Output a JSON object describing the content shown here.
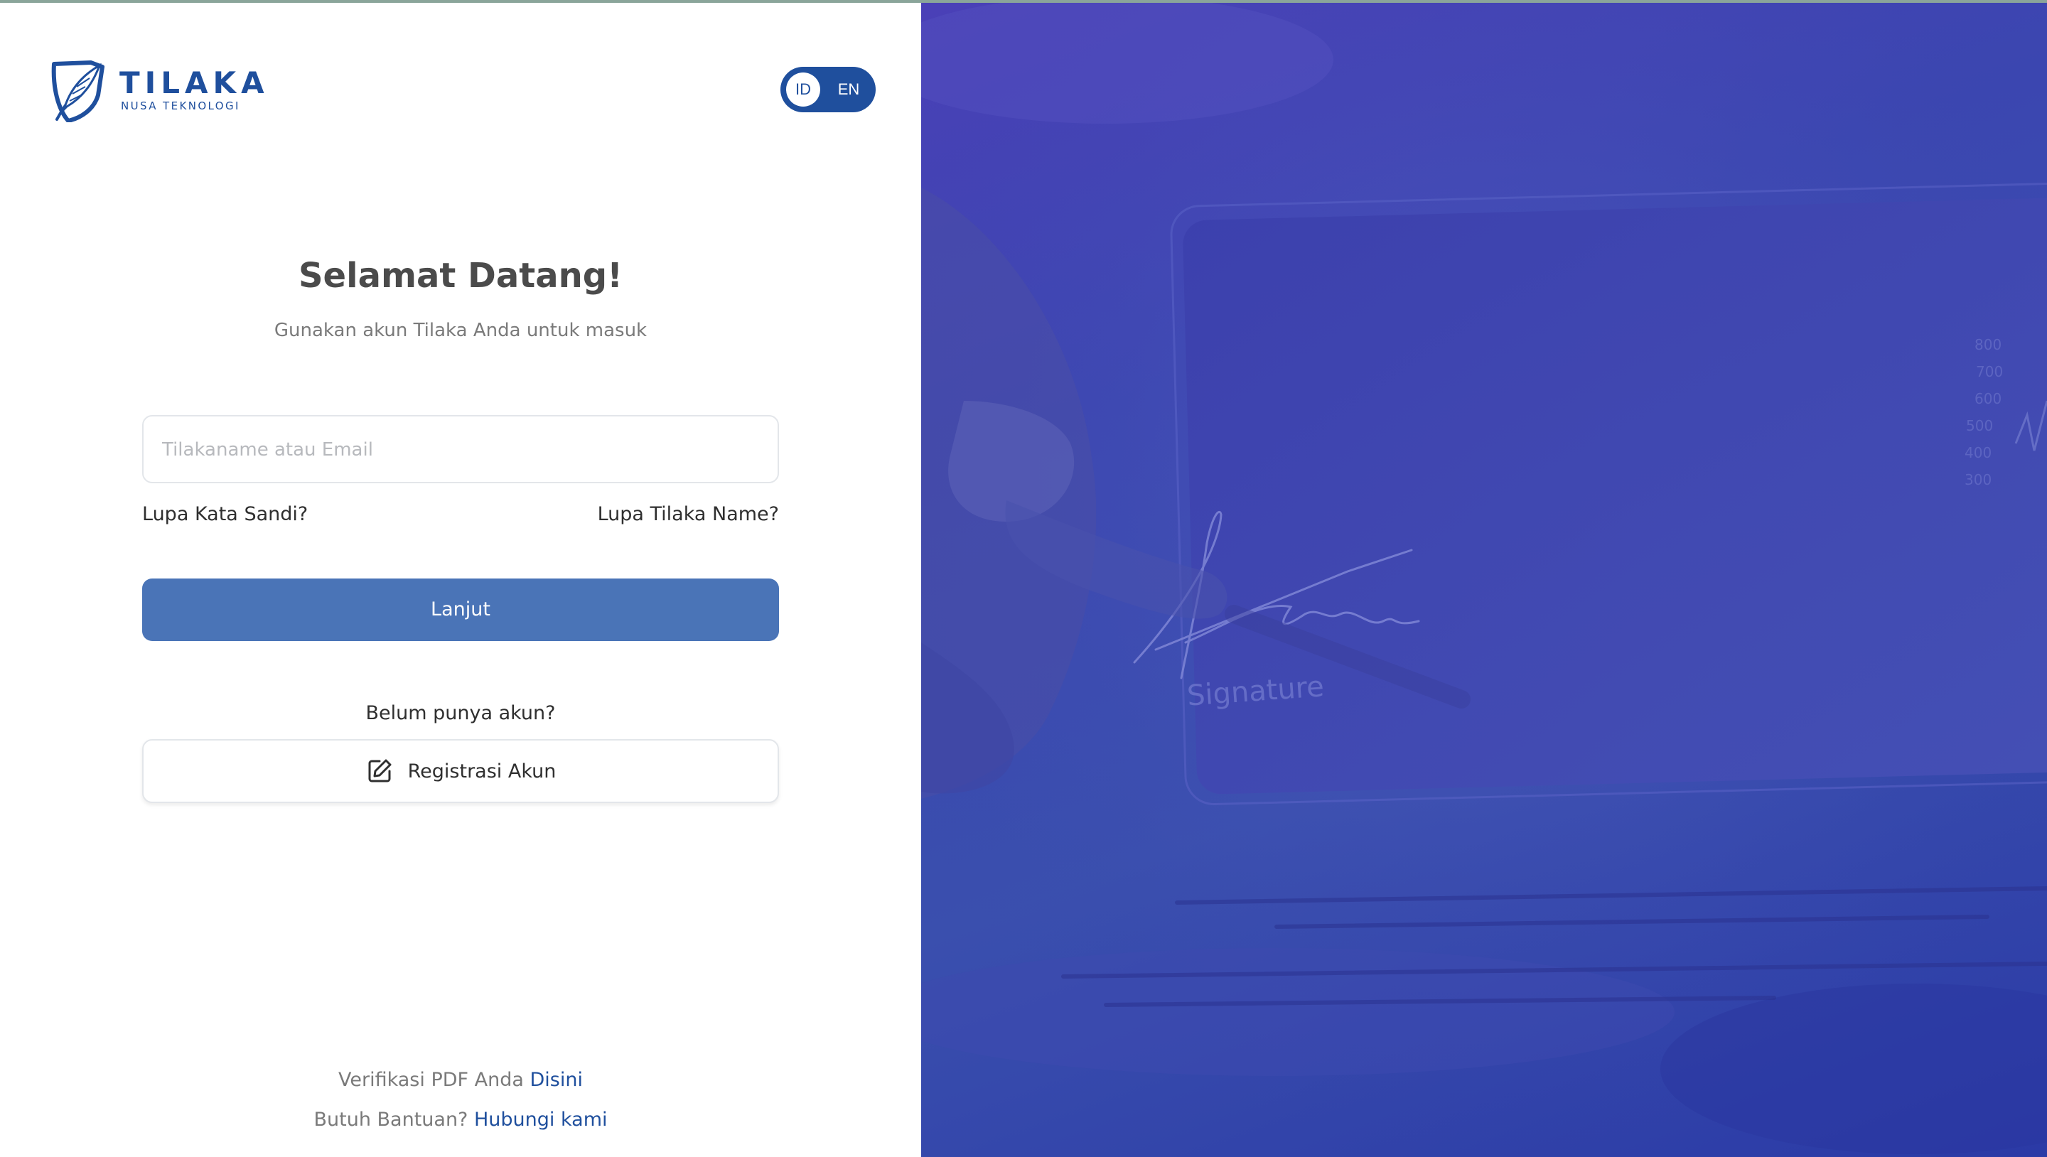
{
  "brand": {
    "name": "TILAKA",
    "tagline": "NUSA TEKNOLOGI",
    "color": "#1f4f9d"
  },
  "language": {
    "options": [
      "ID",
      "EN"
    ],
    "selected": "ID"
  },
  "login": {
    "title": "Selamat Datang!",
    "subtitle": "Gunakan akun Tilaka Anda untuk masuk",
    "username_placeholder": "Tilakaname atau Email",
    "username_value": "",
    "forgot_password": "Lupa Kata Sandi?",
    "forgot_tilaka_name": "Lupa Tilaka Name?",
    "submit_label": "Lanjut",
    "submit_color": "#4a74b7"
  },
  "register": {
    "prompt": "Belum punya akun?",
    "button_label": "Registrasi Akun",
    "icon": "edit-icon"
  },
  "footer": {
    "verify_text": "Verifikasi PDF Anda",
    "verify_link": "Disini",
    "help_text": "Butuh Bantuan?",
    "help_link": "Hubungi kami"
  },
  "hero": {
    "overlay_color": "#3b46b0",
    "signature_caption": "Signature"
  }
}
